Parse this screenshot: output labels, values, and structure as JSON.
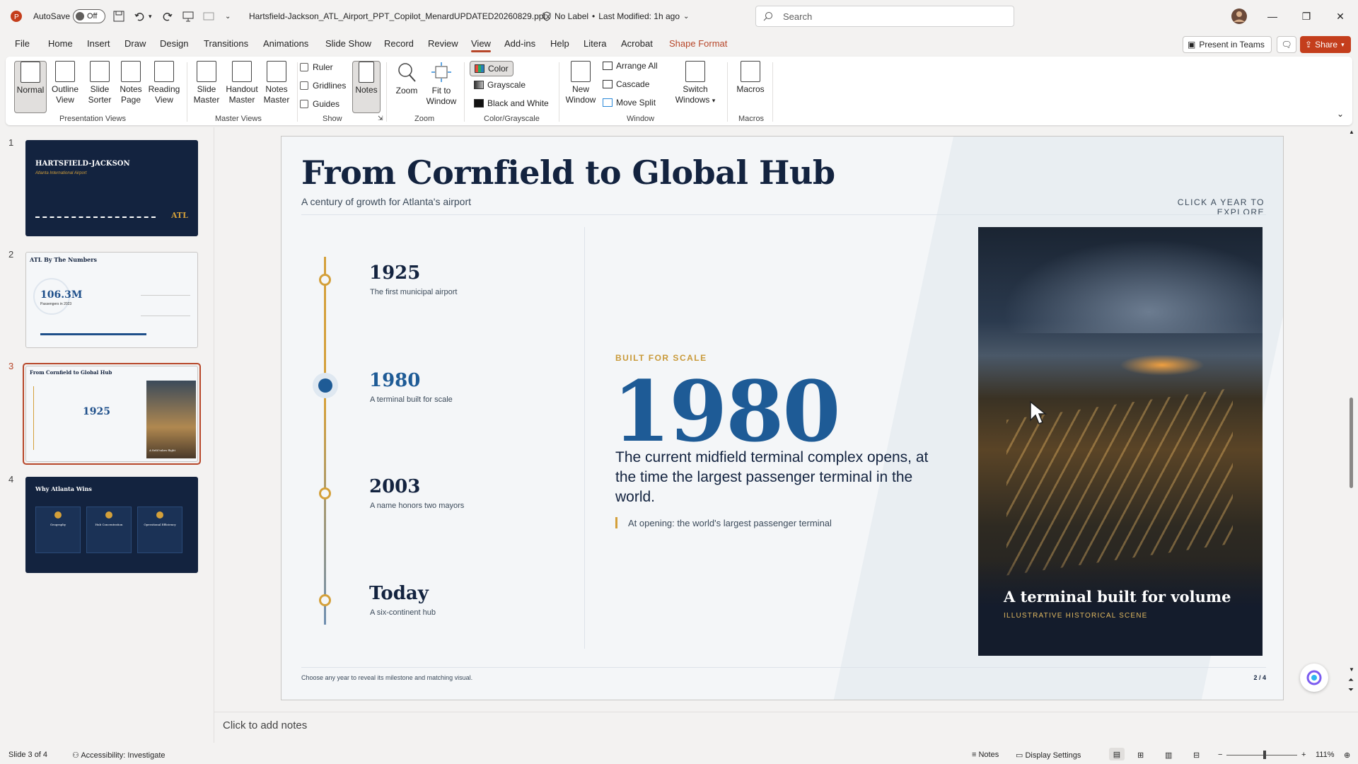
{
  "app": {
    "autosave_label": "AutoSave",
    "autosave_state": "Off",
    "filename": "Hartsfield-Jackson_ATL_Airport_PPT_Copilot_MenardUPDATED20260829.pptx",
    "label": "No Label",
    "modified": "Last Modified: 1h ago",
    "search_placeholder": "Search"
  },
  "menu": {
    "tabs": [
      "File",
      "Home",
      "Insert",
      "Draw",
      "Design",
      "Transitions",
      "Animations",
      "Slide Show",
      "Record",
      "Review",
      "View",
      "Add-ins",
      "Help",
      "Litera",
      "Acrobat",
      "Shape Format"
    ],
    "present_teams": "Present in Teams",
    "share": "Share"
  },
  "ribbon": {
    "presentation_views": {
      "label": "Presentation Views",
      "normal": "Normal",
      "outline1": "Outline",
      "outline2": "View",
      "sorter1": "Slide",
      "sorter2": "Sorter",
      "notes1": "Notes",
      "notes2": "Page",
      "reading1": "Reading",
      "reading2": "View"
    },
    "master_views": {
      "label": "Master Views",
      "slide1": "Slide",
      "slide2": "Master",
      "handout1": "Handout",
      "handout2": "Master",
      "notes1": "Notes",
      "notes2": "Master"
    },
    "show": {
      "label": "Show",
      "ruler": "Ruler",
      "gridlines": "Gridlines",
      "guides": "Guides",
      "notes": "Notes"
    },
    "zoom": {
      "label": "Zoom",
      "zoom": "Zoom",
      "fit1": "Fit to",
      "fit2": "Window"
    },
    "color": {
      "label": "Color/Grayscale",
      "color": "Color",
      "grayscale": "Grayscale",
      "bw": "Black and White"
    },
    "window": {
      "label": "Window",
      "new1": "New",
      "new2": "Window",
      "arrange": "Arrange All",
      "cascade": "Cascade",
      "split": "Move Split",
      "switch1": "Switch",
      "switch2": "Windows"
    },
    "macros": {
      "label": "Macros",
      "macros": "Macros"
    }
  },
  "thumbnails": [
    {
      "num": "1",
      "title": "HARTSFIELD-JACKSON",
      "subtitle": "Atlanta International Airport",
      "tag": "ATL"
    },
    {
      "num": "2",
      "title": "ATL By The Numbers",
      "big": "106.3M",
      "caption": "Passengers in 2023"
    },
    {
      "num": "3",
      "title": "From Cornfield to Global Hub",
      "year": "1925",
      "caption": "A field takes flight"
    },
    {
      "num": "4",
      "title": "Why Atlanta Wins",
      "cards": [
        "Geography",
        "Hub Concentration",
        "Operational Efficiency"
      ]
    }
  ],
  "slide": {
    "title": "From Cornfield to Global Hub",
    "subtitle": "A century of growth for Atlanta's airport",
    "cta": "CLICK A YEAR TO EXPLORE",
    "timeline": [
      {
        "year": "1925",
        "desc": "The first municipal airport"
      },
      {
        "year": "1980",
        "desc": "A terminal built for scale"
      },
      {
        "year": "2003",
        "desc": "A name honors two mayors"
      },
      {
        "year": "Today",
        "desc": "A six-continent hub"
      }
    ],
    "detail": {
      "eyebrow": "BUILT FOR SCALE",
      "year": "1980",
      "body": "The current midfield terminal complex opens, at the time the largest passenger terminal in the world.",
      "note": "At opening: the world's largest passenger terminal"
    },
    "image": {
      "caption": "A terminal built for volume",
      "sub": "ILLUSTRATIVE HISTORICAL SCENE"
    },
    "footer": "Choose any year to reveal its milestone and matching visual.",
    "page": "2 / 4"
  },
  "notes_placeholder": "Click to add notes",
  "status": {
    "slide": "Slide 3 of 4",
    "accessibility": "Accessibility: Investigate",
    "notes": "Notes",
    "display": "Display Settings",
    "zoom": "111%"
  }
}
